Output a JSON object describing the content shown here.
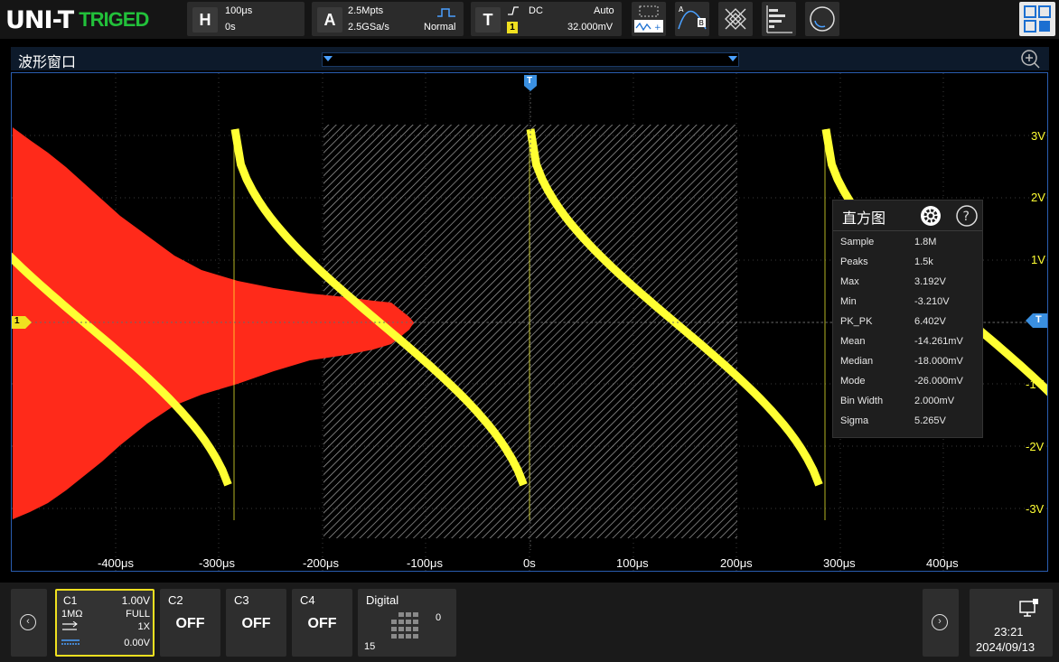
{
  "brand": {
    "logo": "UNI-T",
    "status": "TRIGED"
  },
  "horizontal": {
    "key": "H",
    "timebase": "100μs",
    "delay": "0s"
  },
  "acquire": {
    "key": "A",
    "depth": "2.5Mpts",
    "rate": "2.5GSa/s",
    "mode": "Normal"
  },
  "trigger": {
    "key": "T",
    "coupling": "DC",
    "sweep": "Auto",
    "source": "1",
    "level": "32.000mV"
  },
  "window": {
    "title": "波形窗口"
  },
  "plot": {
    "xticks": [
      "-400μs",
      "-300μs",
      "-200μs",
      "-100μs",
      "0s",
      "100μs",
      "200μs",
      "300μs",
      "400μs"
    ],
    "yticks": [
      "3V",
      "2V",
      "1V",
      "-1V",
      "-2V",
      "-3V"
    ],
    "trigger_marker": "T",
    "channel_marker": "1",
    "level_marker": "T"
  },
  "histogram": {
    "title": "直方图",
    "rows": [
      {
        "key": "Sample",
        "value": "1.8M"
      },
      {
        "key": "Peaks",
        "value": "1.5k"
      },
      {
        "key": "Max",
        "value": "3.192V"
      },
      {
        "key": "Min",
        "value": "-3.210V"
      },
      {
        "key": "PK_PK",
        "value": "6.402V"
      },
      {
        "key": "Mean",
        "value": "-14.261mV"
      },
      {
        "key": "Median",
        "value": "-18.000mV"
      },
      {
        "key": "Mode",
        "value": "-26.000mV"
      },
      {
        "key": "Bin Width",
        "value": "2.000mV"
      },
      {
        "key": "Sigma",
        "value": "5.265V"
      }
    ]
  },
  "channels": {
    "c1": {
      "name": "C1",
      "scale": "1.00V",
      "impedance": "1MΩ",
      "bandwidth": "FULL",
      "probe": "1X",
      "offset": "0.00V"
    },
    "c2": {
      "name": "C2",
      "state": "OFF"
    },
    "c3": {
      "name": "C3",
      "state": "OFF"
    },
    "c4": {
      "name": "C4",
      "state": "OFF"
    },
    "digital": {
      "name": "Digital",
      "low": "0",
      "high": "15"
    }
  },
  "clock": {
    "time": "23:21",
    "date": "2024/09/13"
  },
  "colors": {
    "ch1": "#ffff33",
    "math": "#ff2a1a",
    "accent": "#2a5db0",
    "status": "#22c03a"
  }
}
